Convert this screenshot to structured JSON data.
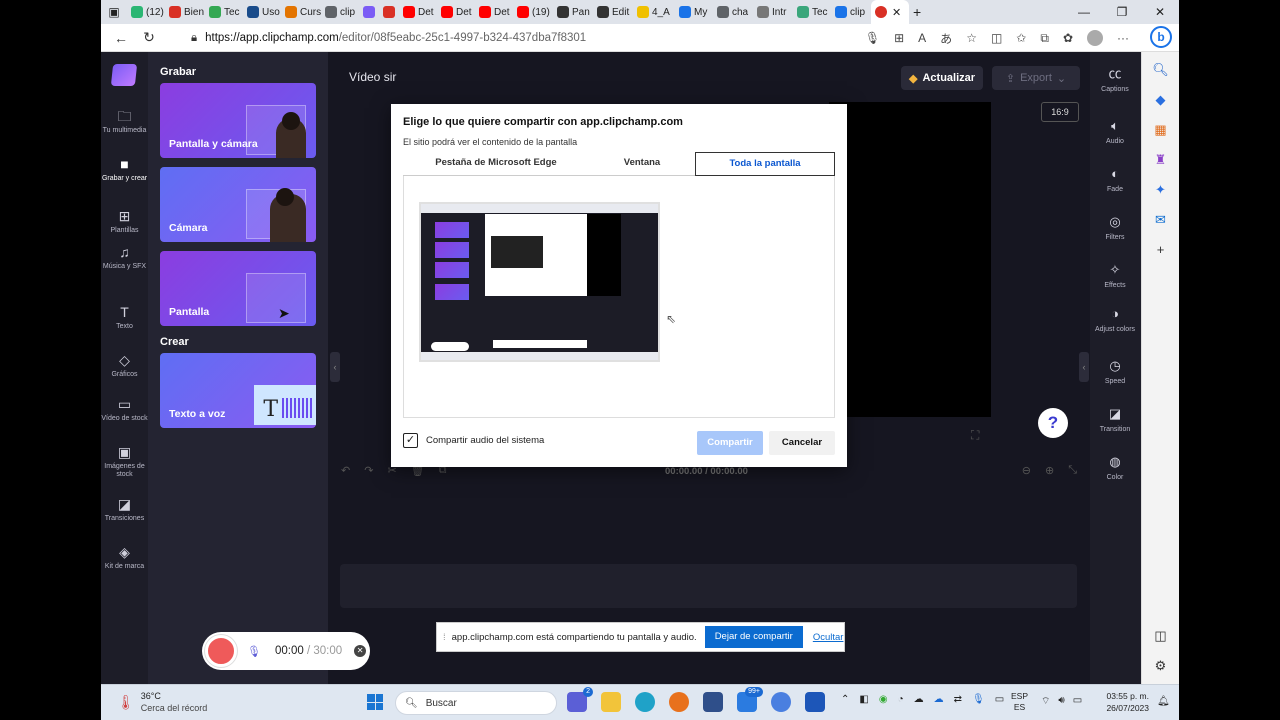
{
  "browser": {
    "tabs": [
      {
        "label": "(12)",
        "color": "#2bb673"
      },
      {
        "label": "Bien",
        "color": "#d93025"
      },
      {
        "label": "Tec",
        "color": "#34a853"
      },
      {
        "label": "Uso",
        "color": "#1a4c8b"
      },
      {
        "label": "Curs",
        "color": "#e37400"
      },
      {
        "label": "clip",
        "color": "#5f6368"
      },
      {
        "label": "",
        "color": "#7b5cf5"
      },
      {
        "label": "",
        "color": "#d93025"
      },
      {
        "label": "Det",
        "color": "#ff0000"
      },
      {
        "label": "Det",
        "color": "#ff0000"
      },
      {
        "label": "Det",
        "color": "#ff0000"
      },
      {
        "label": "(19)",
        "color": "#ff0000"
      },
      {
        "label": "Pan",
        "color": "#333333"
      },
      {
        "label": "Edit",
        "color": "#333333"
      },
      {
        "label": "4_A",
        "color": "#f0c000"
      },
      {
        "label": "My",
        "color": "#1a73e8"
      },
      {
        "label": "cha",
        "color": "#5f6368"
      },
      {
        "label": "Intr",
        "color": "#777777"
      },
      {
        "label": "Tec",
        "color": "#3aa67b"
      },
      {
        "label": "clip",
        "color": "#1a73e8"
      }
    ],
    "active_tab": {
      "label": "",
      "color": "#d93025"
    },
    "url_domain": "https://app.clipchamp.com",
    "url_path": "/editor/08f5eabc-25c1-4997-b324-437dba7f8301",
    "bing_label": "b"
  },
  "leftnav": {
    "items": [
      {
        "label": "Tu multimedia",
        "icon": "folder-icon"
      },
      {
        "label": "Grabar y crear",
        "icon": "video-camera-icon"
      },
      {
        "label": "Plantillas",
        "icon": "templates-icon"
      },
      {
        "label": "Música y SFX",
        "icon": "music-icon"
      },
      {
        "label": "Texto",
        "icon": "text-icon"
      },
      {
        "label": "Gráficos",
        "icon": "shapes-icon"
      },
      {
        "label": "Vídeo de stock",
        "icon": "film-icon"
      },
      {
        "label": "Imágenes de stock",
        "icon": "image-icon"
      },
      {
        "label": "Transiciones",
        "icon": "transition-icon"
      },
      {
        "label": "Kit de marca",
        "icon": "brand-kit-icon"
      }
    ]
  },
  "panel": {
    "record_heading": "Grabar",
    "create_heading": "Crear",
    "cards": {
      "screen_camera": "Pantalla y cámara",
      "camera": "Cámara",
      "screen": "Pantalla",
      "tts": "Texto a voz"
    },
    "tts_letter": "T"
  },
  "recorder": {
    "elapsed": "00:00",
    "separator": "/",
    "limit": "30:00"
  },
  "editor": {
    "project_title": "Vídeo sir",
    "upgrade_label": "Actualizar",
    "export_label": "Export",
    "aspect_ratio": "16:9",
    "help_label": "?",
    "timecode": "00:00.00 / 00:00.00"
  },
  "props": {
    "items": [
      {
        "label": "Captions",
        "icon": "cc-icon"
      },
      {
        "label": "Audio",
        "icon": "speaker-icon"
      },
      {
        "label": "Fade",
        "icon": "fade-icon"
      },
      {
        "label": "Filters",
        "icon": "filters-icon"
      },
      {
        "label": "Effects",
        "icon": "magic-wand-icon"
      },
      {
        "label": "Adjust colors",
        "icon": "contrast-icon"
      },
      {
        "label": "Speed",
        "icon": "speedometer-icon"
      },
      {
        "label": "Transition",
        "icon": "transition-icon"
      },
      {
        "label": "Color",
        "icon": "palette-icon"
      }
    ]
  },
  "share_dialog": {
    "title": "Elige lo que quiere compartir con app.clipchamp.com",
    "subtitle": "El sitio podrá ver el contenido de la pantalla",
    "tabs": [
      "Pestaña de Microsoft Edge",
      "Ventana",
      "Toda la pantalla"
    ],
    "selected_tab": 2,
    "audio_checkbox_label": "Compartir audio del sistema",
    "audio_checked": true,
    "share_button": "Compartir",
    "cancel_button": "Cancelar"
  },
  "share_banner": {
    "message": "app.clipchamp.com está compartiendo tu pantalla y audio.",
    "stop_button": "Dejar de compartir",
    "hide_link": "Ocultar"
  },
  "taskbar": {
    "temperature": "36°C",
    "weather_note": "Cerca del récord",
    "search_placeholder": "Buscar",
    "chat_badge": "2",
    "mail_badge": "99+",
    "language": "ESP",
    "region": "ES",
    "time": "03:55 p. m.",
    "date": "26/07/2023"
  }
}
